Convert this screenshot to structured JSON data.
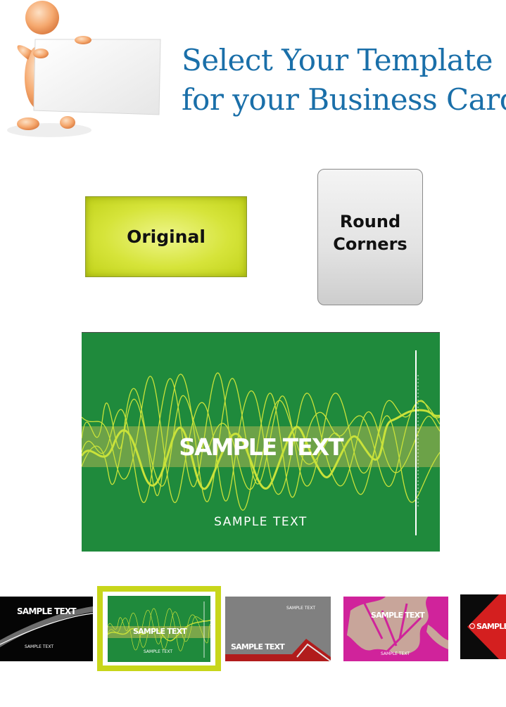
{
  "header": {
    "title_line1": "Select Your Template",
    "title_line2": "for your Business Card"
  },
  "options": {
    "original_label": "Original",
    "round_label_line1": "Round",
    "round_label_line2": "Corners"
  },
  "preview": {
    "main_text": "SAMPLE TEXT",
    "sub_text": "SAMPLE TEXT"
  },
  "templates": [
    {
      "main_text": "SAMPLE TEXT",
      "sub_text": "SAMPLE TEXT",
      "selected": false
    },
    {
      "main_text": "SAMPLE TEXT",
      "sub_text": "SAMPLE TEXT",
      "selected": true
    },
    {
      "main_text": "SAMPLE TEXT",
      "sub_text": "SAMPLE TEXT",
      "selected": false
    },
    {
      "main_text": "SAMPLE TEXT",
      "sub_text": "SAMPLE TEXT",
      "selected": false
    },
    {
      "main_text": "SAMPLE",
      "selected": false
    }
  ],
  "colors": {
    "title": "#1a6fa9",
    "preview_bg": "#1f8a3c",
    "selection_frame": "#c8d61a",
    "wave": "#c9e23a"
  }
}
